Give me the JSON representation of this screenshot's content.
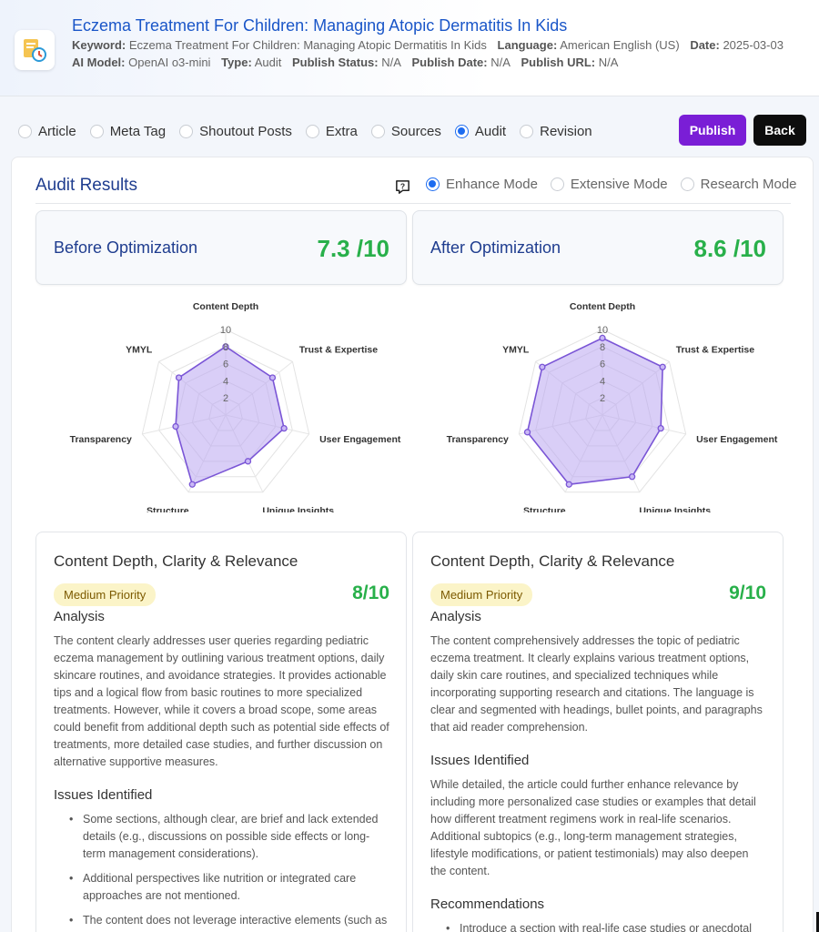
{
  "header": {
    "title": "Eczema Treatment For Children: Managing Atopic Dermatitis In Kids",
    "line1": [
      {
        "label": "Keyword:",
        "value": "Eczema Treatment For Children: Managing Atopic Dermatitis In Kids"
      },
      {
        "label": "Language:",
        "value": "American English (US)"
      },
      {
        "label": "Date:",
        "value": "2025-03-03"
      }
    ],
    "line2": [
      {
        "label": "AI Model:",
        "value": "OpenAI o3-mini"
      },
      {
        "label": "Type:",
        "value": "Audit"
      },
      {
        "label": "Publish Status:",
        "value": "N/A"
      },
      {
        "label": "Publish Date:",
        "value": "N/A"
      },
      {
        "label": "Publish URL:",
        "value": "N/A"
      }
    ]
  },
  "tabs": [
    {
      "label": "Article",
      "selected": false
    },
    {
      "label": "Meta Tag",
      "selected": false
    },
    {
      "label": "Shoutout Posts",
      "selected": false
    },
    {
      "label": "Extra",
      "selected": false
    },
    {
      "label": "Sources",
      "selected": false
    },
    {
      "label": "Audit",
      "selected": true
    },
    {
      "label": "Revision",
      "selected": false
    }
  ],
  "buttons": {
    "publish": "Publish",
    "back": "Back"
  },
  "audit": {
    "title": "Audit Results",
    "modes": [
      {
        "label": "Enhance Mode",
        "selected": true
      },
      {
        "label": "Extensive Mode",
        "selected": false
      },
      {
        "label": "Research Mode",
        "selected": false
      }
    ],
    "before": {
      "label": "Before Optimization",
      "score": "7.3 /10"
    },
    "after": {
      "label": "After Optimization",
      "score": "8.6 /10"
    }
  },
  "chart_data": [
    {
      "type": "radar",
      "categories": [
        "Content Depth",
        "Trust & Expertise",
        "User Engagement",
        "Unique Insights",
        "Structure",
        "Transparency",
        "YMYL"
      ],
      "rlim": [
        0,
        10
      ],
      "ticks": [
        "2",
        "4",
        "6",
        "8",
        "10"
      ],
      "series": [
        {
          "values": [
            8,
            7,
            7,
            6,
            9,
            6,
            7
          ]
        }
      ],
      "fill": "#b9a6f0",
      "stroke": "#7a55d6"
    },
    {
      "type": "radar",
      "categories": [
        "Content Depth",
        "Trust & Expertise",
        "User Engagement",
        "Unique Insights",
        "Structure",
        "Transparency",
        "YMYL"
      ],
      "rlim": [
        0,
        10
      ],
      "ticks": [
        "2",
        "4",
        "6",
        "8",
        "10"
      ],
      "series": [
        {
          "values": [
            9,
            9,
            7,
            8,
            9,
            9,
            9
          ]
        }
      ],
      "fill": "#b9a6f0",
      "stroke": "#7a55d6"
    }
  ],
  "details": [
    {
      "title": "Content Depth, Clarity & Relevance",
      "priority": "Medium Priority",
      "score": "8/10",
      "analysis_heading": "Analysis",
      "analysis": "The content clearly addresses user queries regarding pediatric eczema management by outlining various treatment options, daily skincare routines, and avoidance strategies. It provides actionable tips and a logical flow from basic routines to more specialized treatments. However, while it covers a broad scope, some areas could benefit from additional depth such as potential side effects of treatments, more detailed case studies, and further discussion on alternative supportive measures.",
      "issues_heading": "Issues Identified",
      "issues": [
        "Some sections, although clear, are brief and lack extended details (e.g., discussions on possible side effects or long-term management considerations).",
        "Additional perspectives like nutrition or integrated care approaches are not mentioned.",
        "The content does not leverage interactive elements (such as infographics or video explanations) that could enhance"
      ]
    },
    {
      "title": "Content Depth, Clarity & Relevance",
      "priority": "Medium Priority",
      "score": "9/10",
      "analysis_heading": "Analysis",
      "analysis": "The content comprehensively addresses the topic of pediatric eczema treatment. It clearly explains various treatment options, daily skin care routines, and specialized techniques while incorporating supporting research and citations. The language is clear and segmented with headings, bullet points, and paragraphs that aid reader comprehension.",
      "issues_heading": "Issues Identified",
      "issues_text": "While detailed, the article could further enhance relevance by including more personalized case studies or examples that detail how different treatment regimens work in real-life scenarios. Additional subtopics (e.g., long-term management strategies, lifestyle modifications, or patient testimonials) may also deepen the content.",
      "recommendations_heading": "Recommendations",
      "recommendations": [
        "Introduce a section with real-life case studies or anecdotal"
      ]
    }
  ]
}
